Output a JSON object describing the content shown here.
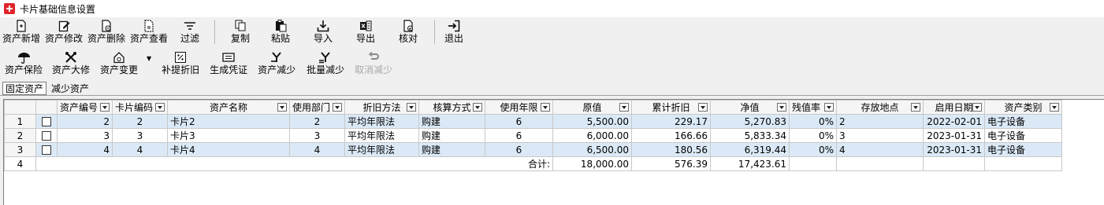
{
  "window": {
    "title": "卡片基础信息设置"
  },
  "toolbar1": [
    {
      "name": "asset-add-button",
      "icon": "new-document-icon",
      "label": "资产新增"
    },
    {
      "name": "asset-edit-button",
      "icon": "edit-icon",
      "label": "资产修改"
    },
    {
      "name": "asset-delete-button",
      "icon": "delete-document-icon",
      "label": "资产删除"
    },
    {
      "name": "asset-view-button",
      "icon": "view-document-icon",
      "label": "资产查看"
    },
    {
      "name": "filter-button",
      "icon": "filter-icon",
      "label": "过滤"
    },
    {
      "name": "copy-button",
      "icon": "copy-icon",
      "label": "复制"
    },
    {
      "name": "paste-button",
      "icon": "paste-icon",
      "label": "粘贴"
    },
    {
      "name": "import-button",
      "icon": "import-icon",
      "label": "导入"
    },
    {
      "name": "export-button",
      "icon": "excel-export-icon",
      "label": "导出"
    },
    {
      "name": "check-button",
      "icon": "check-document-icon",
      "label": "核对"
    },
    {
      "name": "exit-button",
      "icon": "exit-icon",
      "label": "退出"
    }
  ],
  "toolbar2": [
    {
      "name": "asset-insurance-button",
      "icon": "umbrella-icon",
      "label": "资产保险"
    },
    {
      "name": "asset-repair-button",
      "icon": "tools-icon",
      "label": "资产大修"
    },
    {
      "name": "asset-change-button",
      "icon": "house-change-icon",
      "label": "资产变更"
    },
    {
      "name": "supplement-depreciation-button",
      "icon": "percent-icon",
      "label": "补提折旧"
    },
    {
      "name": "generate-voucher-button",
      "icon": "voucher-icon",
      "label": "生成凭证"
    },
    {
      "name": "asset-reduce-button",
      "icon": "reduce-icon",
      "label": "资产减少"
    },
    {
      "name": "batch-reduce-button",
      "icon": "batch-reduce-icon",
      "label": "批量减少"
    },
    {
      "name": "cancel-reduce-button",
      "icon": "undo-icon",
      "label": "取消减少",
      "disabled": true
    }
  ],
  "tabs": [
    {
      "label": "固定资产",
      "active": true
    },
    {
      "label": "减少资产",
      "active": false
    }
  ],
  "table": {
    "columns": [
      "资产编号",
      "卡片编码",
      "资产名称",
      "使用部门",
      "折旧方法",
      "核算方式",
      "使用年限",
      "原值",
      "累计折旧",
      "净值",
      "残值率",
      "存放地点",
      "启用日期",
      "资产类别"
    ],
    "rows": [
      {
        "rownum": "1",
        "cells": [
          "2",
          "2",
          "卡片2",
          "2",
          "平均年限法",
          "购建",
          "6",
          "5,500.00",
          "229.17",
          "5,270.83",
          "0%",
          "2",
          "2022-02-01",
          "电子设备"
        ]
      },
      {
        "rownum": "2",
        "cells": [
          "3",
          "3",
          "卡片3",
          "3",
          "平均年限法",
          "购建",
          "6",
          "6,000.00",
          "166.66",
          "5,833.34",
          "0%",
          "3",
          "2023-01-31",
          "电子设备"
        ]
      },
      {
        "rownum": "3",
        "cells": [
          "4",
          "4",
          "卡片4",
          "4",
          "平均年限法",
          "购建",
          "6",
          "6,500.00",
          "180.56",
          "6,319.44",
          "0%",
          "4",
          "2023-01-31",
          "电子设备"
        ]
      }
    ],
    "total": {
      "rownum": "4",
      "label": "合计:",
      "original_value": "18,000.00",
      "accum_depreciation": "576.39",
      "net_value": "17,423.61"
    }
  },
  "colors": {
    "row_highlight": "#dbe9f7",
    "app_icon": "#e0262a"
  }
}
